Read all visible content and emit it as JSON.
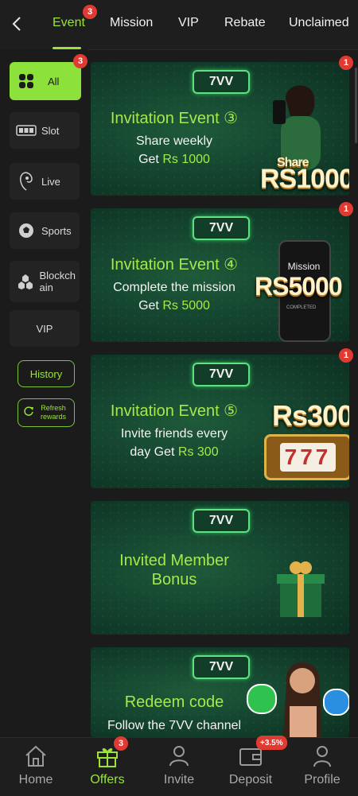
{
  "header": {
    "tabs": [
      {
        "label": "Event",
        "badge": "3",
        "active": true
      },
      {
        "label": "Mission"
      },
      {
        "label": "VIP"
      },
      {
        "label": "Rebate"
      },
      {
        "label": "Unclaimed"
      }
    ],
    "accent": "#9be23a"
  },
  "sidebar": {
    "items": [
      {
        "label": "All",
        "badge": "3",
        "icon": "grid-icon",
        "active": true
      },
      {
        "label": "Slot",
        "icon": "slot-machine-icon"
      },
      {
        "label": "Live",
        "icon": "live-dealer-icon"
      },
      {
        "label": "Sports",
        "icon": "soccer-ball-icon"
      },
      {
        "label": "Blockchain",
        "icon": "blockchain-icon"
      },
      {
        "label": "VIP"
      }
    ],
    "history_label": "History",
    "refresh_label": "Refresh rewards"
  },
  "cards": [
    {
      "brand": "7VV",
      "title": "Invitation Event ③",
      "line1": "Share weekly",
      "line2_prefix": "Get ",
      "line2_amount": "Rs 1000",
      "promo_small": "Share",
      "promo_big": "RS1000",
      "badge": "1"
    },
    {
      "brand": "7VV",
      "title": "Invitation Event ④",
      "line1": "Complete the mission",
      "line2_prefix": "Get ",
      "line2_amount": "Rs 5000",
      "promo_small": "Mission",
      "promo_big": "RS5000",
      "promo_tag": "COMPLETED",
      "badge": "1"
    },
    {
      "brand": "7VV",
      "title": "Invitation Event ⑤",
      "line1": "Invite friends every",
      "line2_prefix": "day Get ",
      "line2_amount": "Rs 300",
      "promo_big": "Rs300",
      "reel": "777",
      "badge": "1"
    },
    {
      "brand": "7VV",
      "title": "Invited Member",
      "title2": "Bonus"
    },
    {
      "brand": "7VV",
      "title": "Redeem code",
      "line1": "Follow the 7VV channel"
    }
  ],
  "bottom_nav": {
    "items": [
      {
        "label": "Home",
        "icon": "home-icon"
      },
      {
        "label": "Offers",
        "icon": "gift-icon",
        "badge": "3",
        "active": true
      },
      {
        "label": "Invite",
        "icon": "invite-icon"
      },
      {
        "label": "Deposit",
        "icon": "wallet-icon",
        "badge": "+3.5%"
      },
      {
        "label": "Profile",
        "icon": "profile-icon"
      }
    ]
  }
}
